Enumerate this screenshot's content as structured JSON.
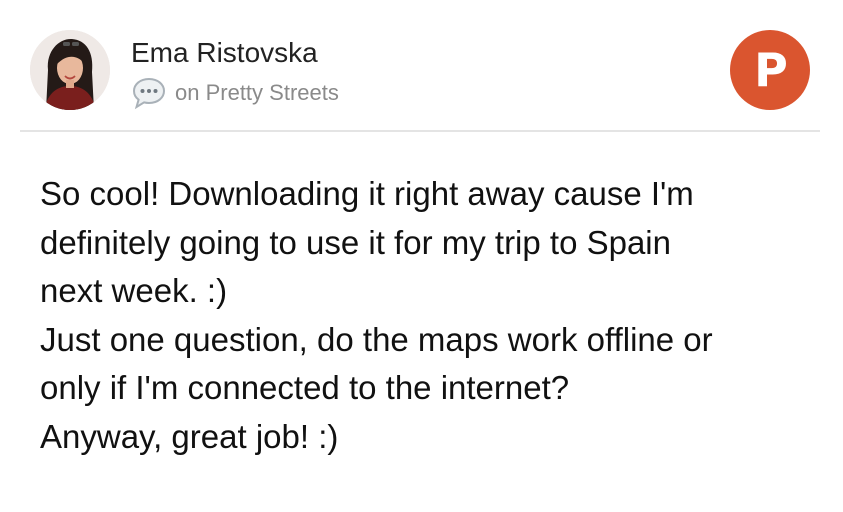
{
  "author": {
    "name": "Ema Ristovska",
    "avatar_icon": "user-avatar-photo"
  },
  "meta": {
    "icon": "comment-bubble-icon",
    "text": "on Pretty Streets"
  },
  "logo": {
    "letter": "P",
    "color": "#da552f",
    "icon": "product-hunt-logo"
  },
  "comment": {
    "lines": [
      "So cool! Downloading it right away cause I'm",
      "definitely going to use it for my trip to Spain",
      "next week. :)",
      "Just one question, do the maps work offline or",
      "only if I'm connected to the internet?",
      "Anyway, great job! :)"
    ]
  }
}
